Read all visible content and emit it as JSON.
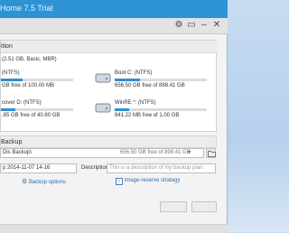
{
  "window": {
    "title": "Home 7.5 Trial",
    "controls": [
      "tools-icon",
      "restore-icon",
      "minimize-icon",
      "close-icon"
    ]
  },
  "source": {
    "header": "ition",
    "disk_info": "(2.51 GB, Basic, MBR)",
    "partitions": [
      {
        "name": "(NTFS)",
        "size": "GB free of 100.00 MB",
        "used_pct": 30,
        "icon": "windows-drive-icon"
      },
      {
        "name": "Boot C: (NTFS)",
        "size": "656.50 GB free of 898.41 GB",
        "used_pct": 27,
        "icon": "hard-drive-icon"
      },
      {
        "name": "cover D: (NTFS)",
        "size": ".85 GB free of 40.80 GB",
        "used_pct": 20,
        "icon": "windows-drive-icon"
      },
      {
        "name": "WinRE *: (NTFS)",
        "size": "841.22 MB free of 1.00 GB",
        "used_pct": 16,
        "icon": "hard-drive-icon"
      }
    ]
  },
  "destination": {
    "header": "Backup",
    "path": "Dis Backup\\",
    "space": "656.50 GB free of 898.41 GB",
    "dropdown_icon": "chevron-down-icon",
    "browse_icon": "folder-icon"
  },
  "plan": {
    "name": "p 2014-11-07 14-16",
    "description_label": "Description:",
    "description_placeholder": "This is a description of my backup plan.",
    "backup_options": "Backup options",
    "image_reserve": "Image-reserve strategy",
    "image_reserve_checked": true
  },
  "footer": {
    "proceed_label": "",
    "cancel_label": ""
  },
  "colors": {
    "accent": "#2d93d5",
    "bar": "#2d8fd4"
  }
}
